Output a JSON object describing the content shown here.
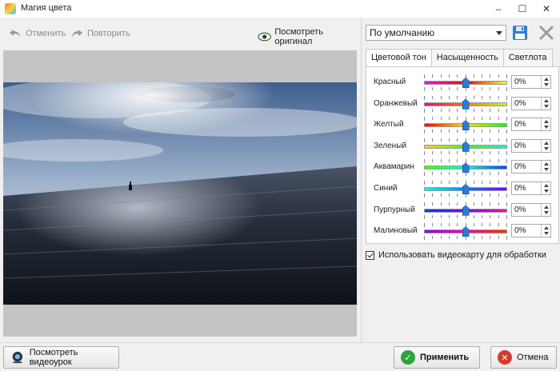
{
  "window": {
    "title": "Магия цвета"
  },
  "toolbar": {
    "undo_label": "Отменить",
    "redo_label": "Повторить",
    "view_original_label": "Посмотреть оригинал"
  },
  "preset": {
    "selected": "По умолчанию"
  },
  "tabs": [
    {
      "label": "Цветовой тон"
    },
    {
      "label": "Насыщенность"
    },
    {
      "label": "Светлота"
    }
  ],
  "adjustments": [
    {
      "label": "Красный",
      "value": "0%",
      "level": 0.5
    },
    {
      "label": "Оранжевый",
      "value": "0%",
      "level": 0.5
    },
    {
      "label": "Желтый",
      "value": "0%",
      "level": 0.5
    },
    {
      "label": "Зеленый",
      "value": "0%",
      "level": 0.5
    },
    {
      "label": "Аквамарин",
      "value": "0%",
      "level": 0.5
    },
    {
      "label": "Синий",
      "value": "0%",
      "level": 0.5
    },
    {
      "label": "Пурпурный",
      "value": "0%",
      "level": 0.5
    },
    {
      "label": "Малиновый",
      "value": "0%",
      "level": 0.5
    }
  ],
  "gpu_option": {
    "label": "Использовать видеокарту для обработки",
    "checked": true
  },
  "bottom": {
    "video_label": "Посмотреть видеоурок",
    "apply_label": "Применить",
    "cancel_label": "Отмена"
  },
  "colors": {
    "accent": "#2b7bd6",
    "apply_green": "#2fa33a",
    "cancel_red": "#d33a2c"
  }
}
